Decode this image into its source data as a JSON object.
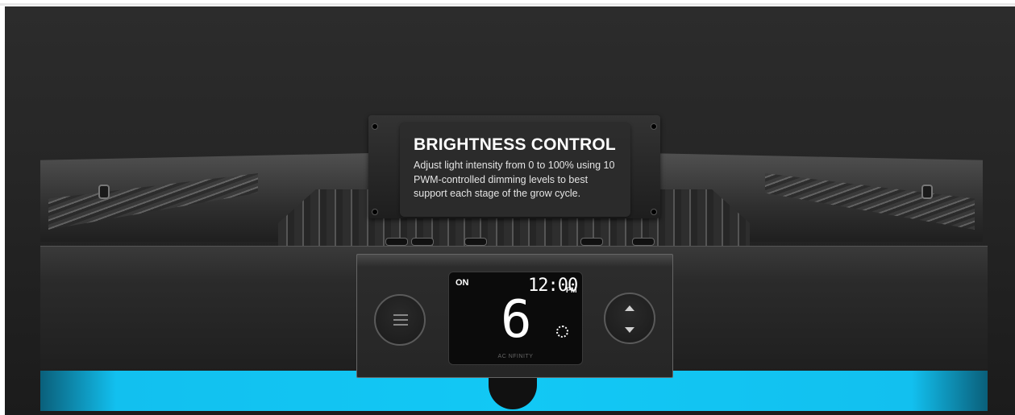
{
  "tooltip": {
    "title": "BRIGHTNESS CONTROL",
    "description": "Adjust light intensity from 0 to 100% using 10 PWM-controlled dimming levels to best support each stage of the grow cycle."
  },
  "display": {
    "power_status": "ON",
    "time": "12:00",
    "meridiem": "PM",
    "brightness_level": "6",
    "brand": "AC NFINITY"
  },
  "controls": {
    "menu_icon": "menu-icon",
    "arrows_icon": "up-down-arrows-icon"
  },
  "colors": {
    "accent_blue": "#12c8f5",
    "housing_dark": "#262626"
  }
}
